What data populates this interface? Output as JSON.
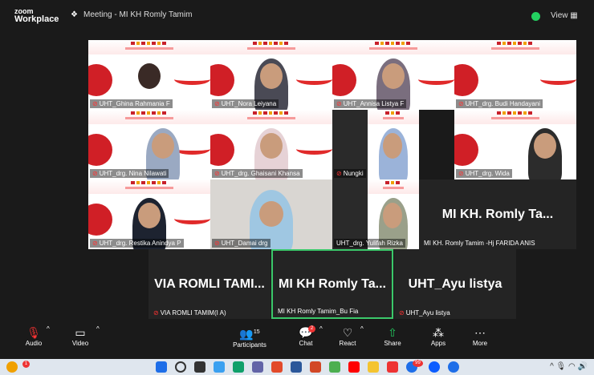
{
  "app": {
    "brand_top": "zoom",
    "brand_bottom": "Workplace",
    "meeting_title": "Meeting - MI KH Romly Tamim",
    "view_label": "View"
  },
  "colors": {
    "accent_green": "#3bc86a",
    "security_green": "#23d160",
    "muted_red": "#ff3333"
  },
  "video_tiles": [
    {
      "name": "UHT_Ghina Rahmania F"
    },
    {
      "name": "UHT_Nora Leiyana"
    },
    {
      "name": "UHT_Annisa Listya F"
    },
    {
      "name": "UHT_drg. Budi Handayani"
    },
    {
      "name": "UHT_drg. Nina Nilawati"
    },
    {
      "name": "UHT_drg. Ghaisani Khansa"
    },
    {
      "name": "Nungki"
    },
    {
      "name": "UHT_drg. Wida"
    },
    {
      "name": "UHT_drg. Restika Anindya P"
    },
    {
      "name": "UHT_Damai drg"
    },
    {
      "name": "UHT_drg. Yulifah Rizka"
    }
  ],
  "name_tiles": [
    {
      "big": "MI KH. Romly Ta...",
      "label": "MI KH. Romly Tamim -Hj FARIDA ANIS"
    },
    {
      "big": "VIA ROMLI TAMI...",
      "label": "VIA ROMLI TAMIM(I A)"
    },
    {
      "big": "MI KH Romly Ta...",
      "label": "MI KH Romly Tamim_Bu Fia"
    },
    {
      "big": "UHT_Ayu listya",
      "label": "UHT_Ayu listya"
    }
  ],
  "toolbar": {
    "audio": "Audio",
    "video": "Video",
    "participants": "Participants",
    "participants_count": "15",
    "chat": "Chat",
    "chat_badge": "2",
    "react": "React",
    "share": "Share",
    "apps": "Apps",
    "more": "More"
  },
  "taskbar": {
    "notif_badge": "1",
    "apps_badge": "99"
  }
}
